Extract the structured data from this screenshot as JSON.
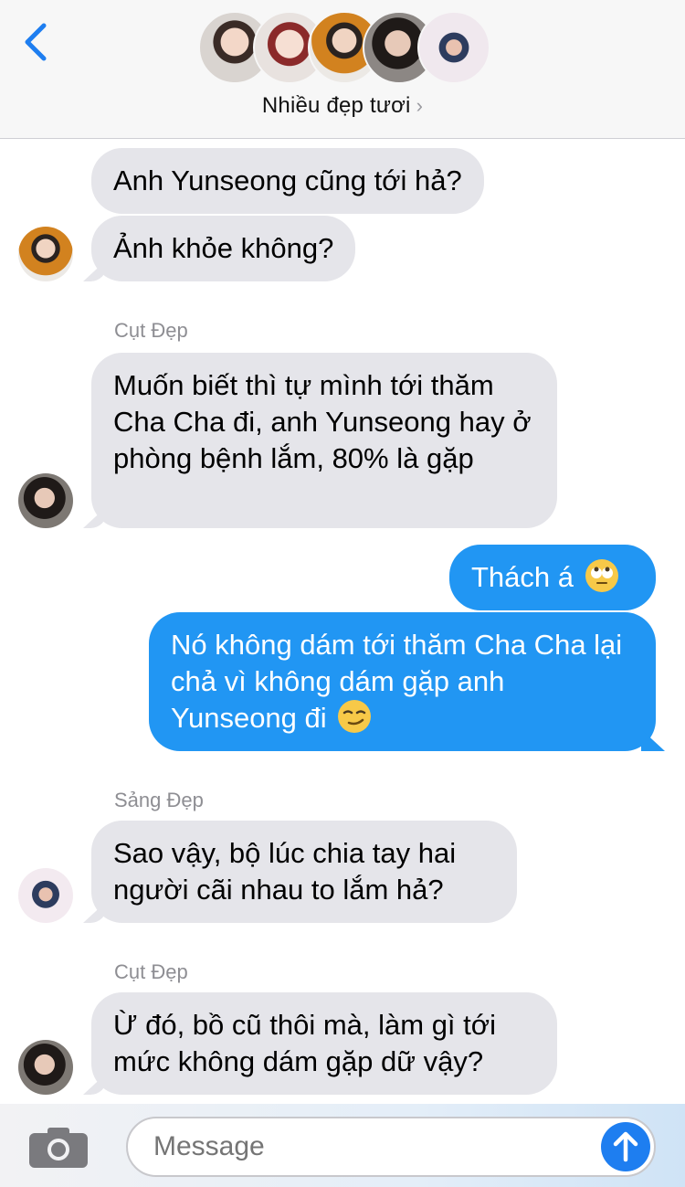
{
  "header": {
    "group_name": "Nhiều đẹp tươi",
    "chevron": "›",
    "back_icon": "chevron-left-icon",
    "accent": "#1e7ef0"
  },
  "messages": [
    {
      "side": "in",
      "text": "Anh Yunseong cũng tới hả?"
    },
    {
      "side": "in",
      "text": "Ảnh khỏe không?"
    },
    {
      "side": "in",
      "sender": "Cụt Đẹp",
      "text": "Muốn biết thì tự mình tới thăm Cha Cha đi, anh Yunseong hay ở phòng bệnh lắm, 80% là gặp"
    },
    {
      "side": "out",
      "text": "Thách á",
      "emoji": "eye-roll-emoji-icon"
    },
    {
      "side": "out",
      "text": "Nó không dám tới thăm Cha Cha lại chả vì không dám gặp anh Yunseong đi",
      "emoji": "smirk-emoji-icon"
    },
    {
      "side": "in",
      "sender": "Sảng Đẹp",
      "text": "Sao vậy, bộ lúc chia tay hai người cãi nhau to lắm hả?"
    },
    {
      "side": "in",
      "sender": "Cụt Đẹp",
      "text": "Ừ đó, bồ cũ thôi mà, làm gì tới mức không dám gặp dữ vậy?"
    }
  ],
  "composer": {
    "placeholder": "Message",
    "camera_icon": "camera-icon",
    "send_icon": "send-arrow-up-icon"
  },
  "colors": {
    "incoming_bubble": "#e5e5ea",
    "outgoing_bubble": "#2196f3",
    "sender_label": "#8e8e93"
  }
}
